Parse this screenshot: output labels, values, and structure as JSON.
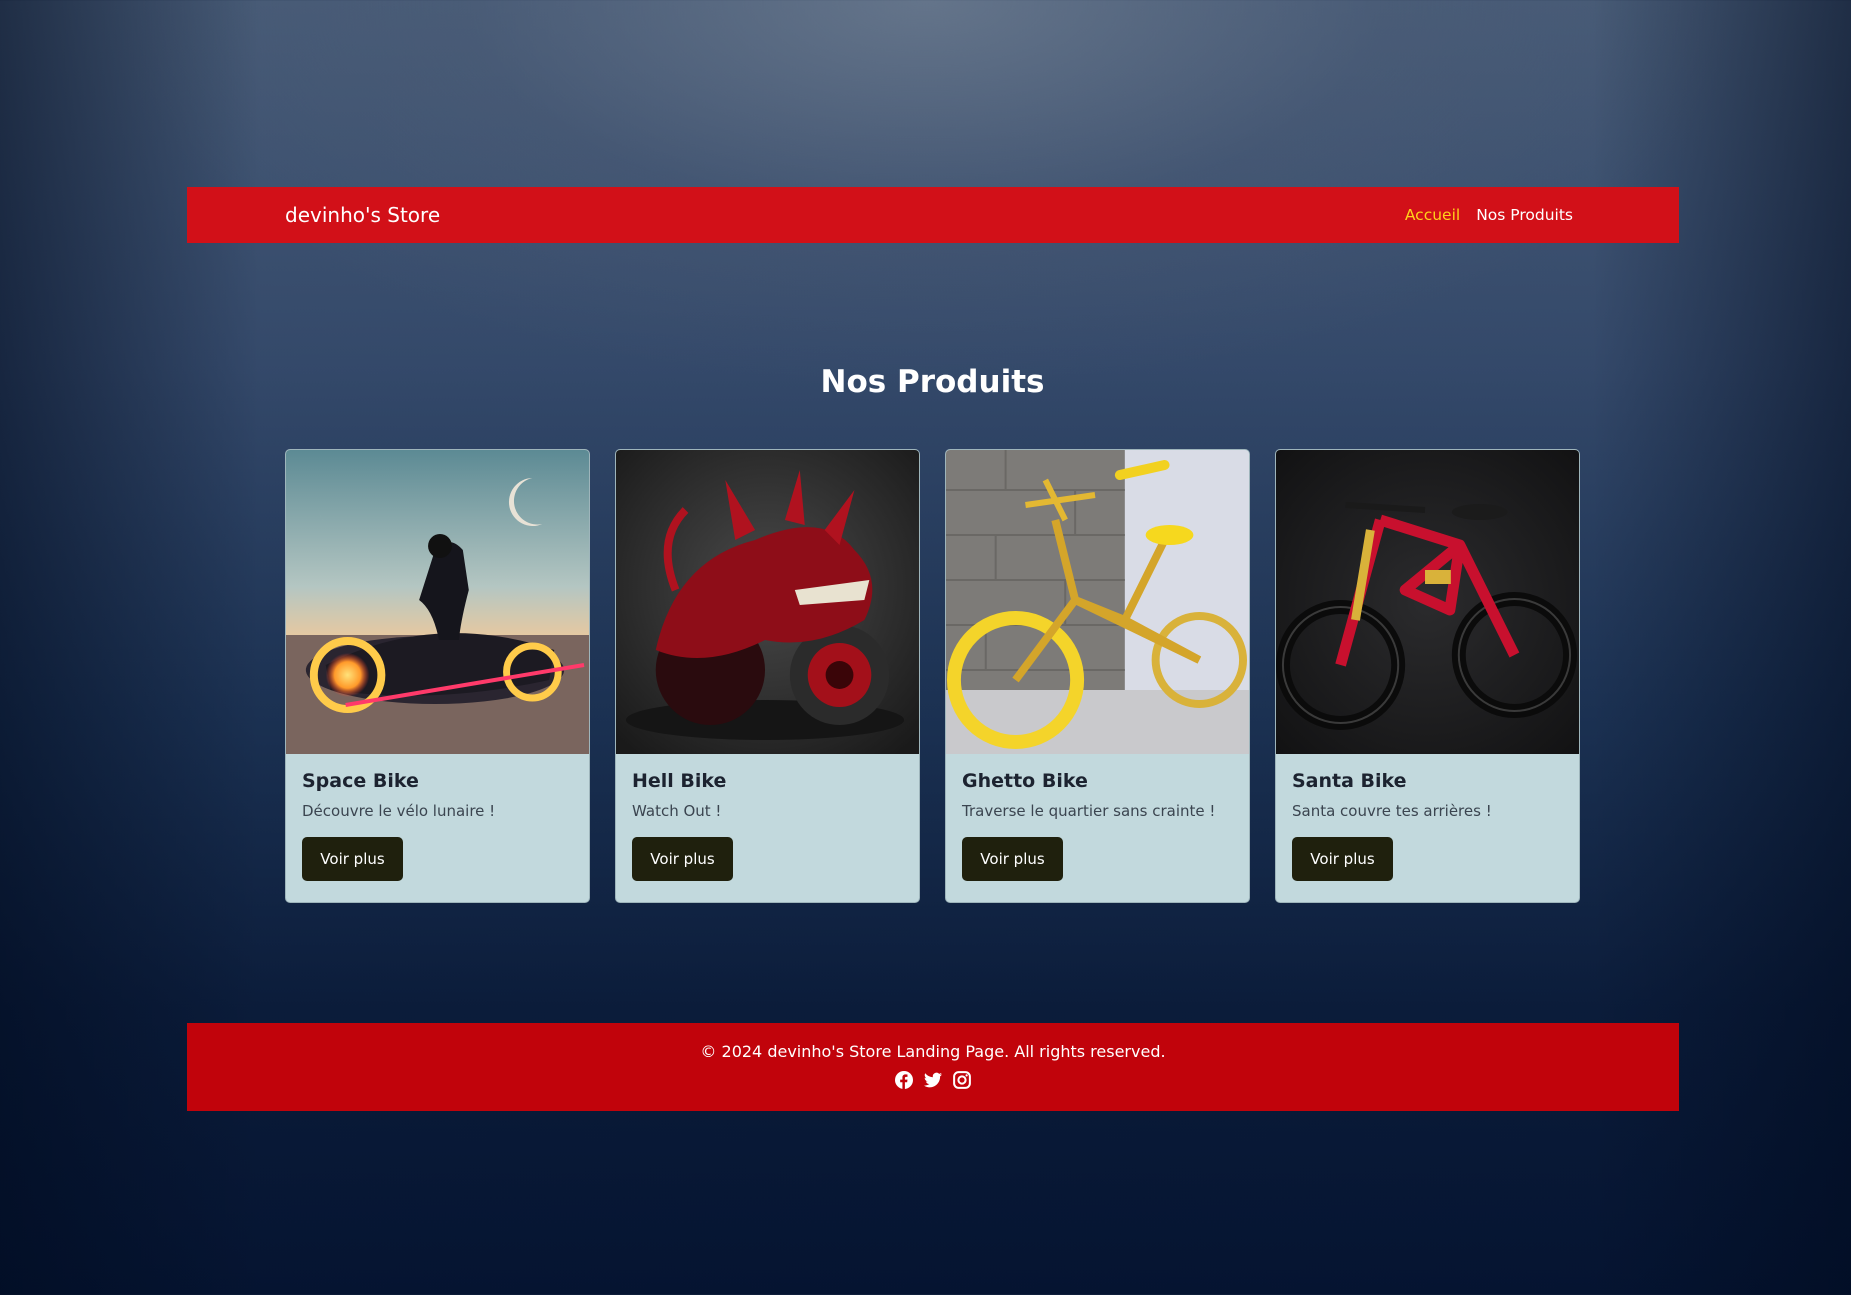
{
  "navbar": {
    "brand": "devinho's Store",
    "links": [
      {
        "label": "Accueil",
        "active": true
      },
      {
        "label": "Nos Produits",
        "active": false
      }
    ]
  },
  "section": {
    "title": "Nos Produits"
  },
  "products": [
    {
      "title": "Space Bike",
      "description": "Découvre le vélo lunaire !",
      "button": "Voir plus",
      "image": "futuristic-motorbike-image"
    },
    {
      "title": "Hell Bike",
      "description": "Watch Out !",
      "button": "Voir plus",
      "image": "red-dragon-motorbike-image"
    },
    {
      "title": "Ghetto Bike",
      "description": "Traverse le quartier sans crainte !",
      "button": "Voir plus",
      "image": "gold-bmx-bike-image"
    },
    {
      "title": "Santa Bike",
      "description": "Santa couvre tes arrières !",
      "button": "Voir plus",
      "image": "red-mountain-bike-image"
    }
  ],
  "footer": {
    "text": "© 2024 devinho's Store Landing Page. All rights reserved.",
    "social": [
      "facebook-icon",
      "twitter-icon",
      "instagram-icon"
    ]
  },
  "colors": {
    "navbar": "#d21018",
    "footer": "#c1030b",
    "active_link": "#ffd21a",
    "card": "#c2d9dd",
    "button": "#1f200d"
  }
}
